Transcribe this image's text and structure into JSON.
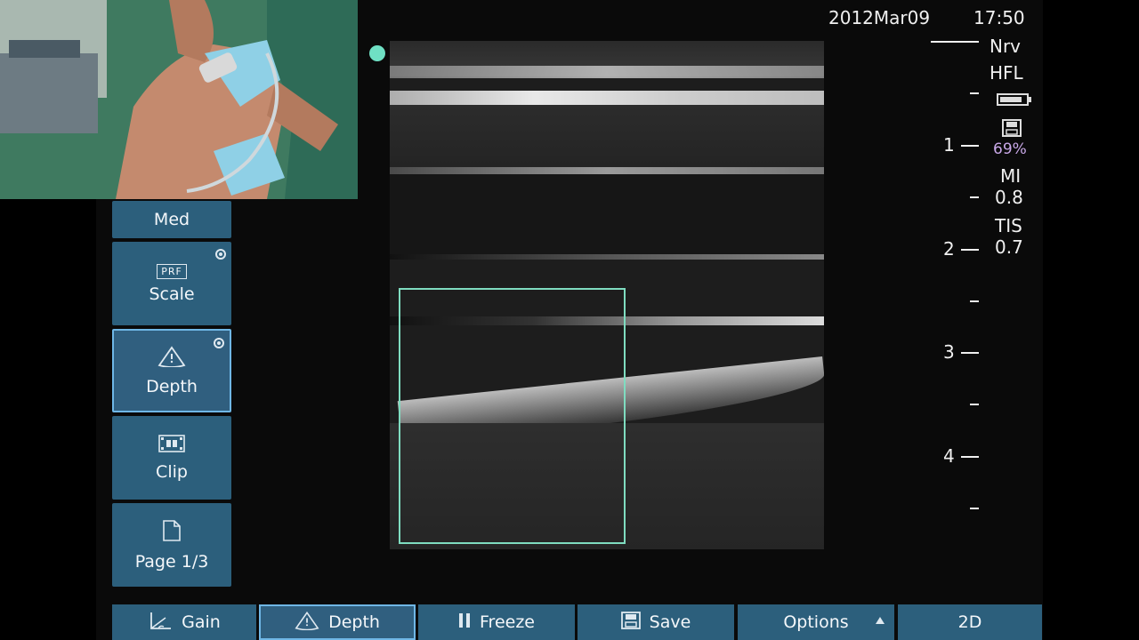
{
  "header": {
    "date": "2012Mar09",
    "time": "17:50"
  },
  "probe": {
    "preset": "Nrv",
    "transducer": "HFL"
  },
  "outputs": {
    "storage": "69%",
    "mi_label": "MI",
    "mi_value": "0.8",
    "tis_label": "TIS",
    "tis_value": "0.7"
  },
  "depth_scale": {
    "labels": [
      "1",
      "2",
      "3",
      "4"
    ]
  },
  "side_menu": {
    "top_label": "Med",
    "scale": {
      "icon": "prf-icon",
      "icon_text": "PRF",
      "label": "Scale"
    },
    "depth": {
      "icon": "depth-icon",
      "label": "Depth"
    },
    "clip": {
      "icon": "film-icon",
      "label": "Clip"
    },
    "page": {
      "icon": "page-icon",
      "label": "Page 1/3"
    }
  },
  "bottom_bar": {
    "gain": "Gain",
    "depth": "Depth",
    "freeze": "Freeze",
    "save": "Save",
    "options": "Options",
    "mode": "2D"
  },
  "colors": {
    "button_bg": "#2c5f7c",
    "button_active_border": "#6fb7e6",
    "roi_box": "#7fdcc0",
    "storage_text": "#c9a8e8"
  }
}
